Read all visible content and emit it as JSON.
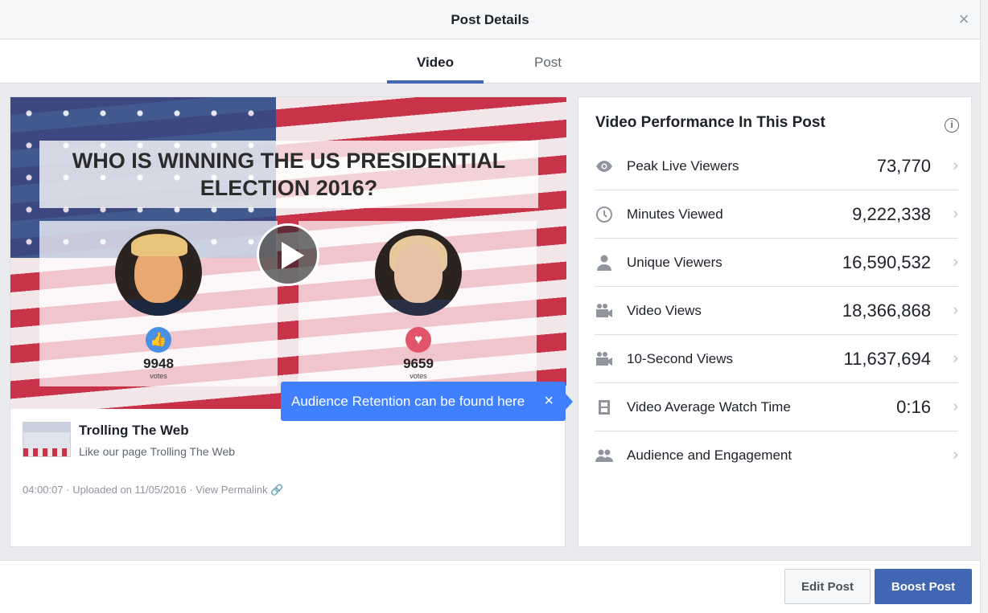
{
  "dialog": {
    "title": "Post Details"
  },
  "tabs": [
    {
      "label": "Video",
      "active": true
    },
    {
      "label": "Post",
      "active": false
    }
  ],
  "video": {
    "banner_line1": "WHO IS WINNING THE US PRESIDENTIAL",
    "banner_line2": "ELECTION 2016?",
    "left_votes": "9948",
    "right_votes": "9659",
    "votes_label": "votes"
  },
  "post": {
    "page_name": "Trolling The Web",
    "description": "Like our page Trolling The Web",
    "duration": "04:00:07",
    "uploaded": "Uploaded on 11/05/2016",
    "permalink": "View Permalink"
  },
  "tooltip": {
    "text": "Audience Retention can be found here"
  },
  "performance": {
    "title": "Video Performance In This Post",
    "metrics": [
      {
        "icon": "eye-icon",
        "label": "Peak Live Viewers",
        "value": "73,770"
      },
      {
        "icon": "clock-icon",
        "label": "Minutes Viewed",
        "value": "9,222,338"
      },
      {
        "icon": "person-icon",
        "label": "Unique Viewers",
        "value": "16,590,532"
      },
      {
        "icon": "video-camera-icon",
        "label": "Video Views",
        "value": "18,366,868"
      },
      {
        "icon": "video-camera-icon",
        "label": "10-Second Views",
        "value": "11,637,694"
      },
      {
        "icon": "film-icon",
        "label": "Video Average Watch Time",
        "value": "0:16"
      },
      {
        "icon": "people-icon",
        "label": "Audience and Engagement",
        "value": ""
      }
    ]
  },
  "footer": {
    "edit_label": "Edit Post",
    "boost_label": "Boost Post"
  },
  "colors": {
    "accent": "#4267b2",
    "tooltip": "#4080ff"
  }
}
